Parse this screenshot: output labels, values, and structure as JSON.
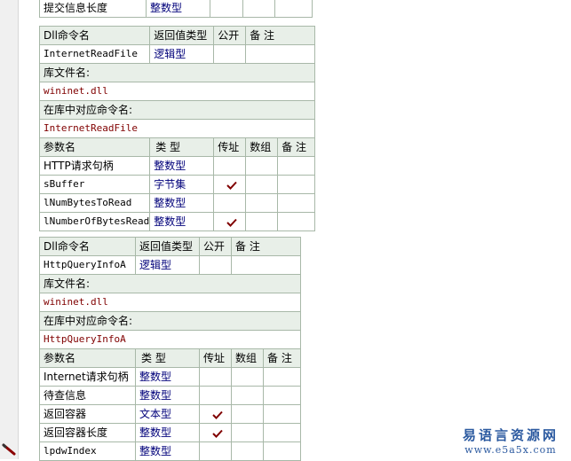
{
  "top_row": {
    "label": "提交信息长度",
    "type": "整数型"
  },
  "headers": {
    "dll_command": "Dll命令名",
    "return_type": "返回值类型",
    "public": "公开",
    "note": "备 注",
    "lib_name": "库文件名:",
    "lib_cmd_name": "在库中对应命令名:",
    "param_name": "参数名",
    "type": "类 型",
    "by_ref": "传址",
    "array": "数组"
  },
  "commands": [
    {
      "name": "InternetReadFile",
      "return_type": "逻辑型",
      "lib_file": "wininet.dll",
      "lib_command": "InternetReadFile",
      "params": [
        {
          "name": "HTTP请求句柄",
          "type": "整数型",
          "by_ref": false
        },
        {
          "name": "sBuffer",
          "type": "字节集",
          "by_ref": true
        },
        {
          "name": "lNumBytesToRead",
          "type": "整数型",
          "by_ref": false
        },
        {
          "name": "lNumberOfBytesRead",
          "type": "整数型",
          "by_ref": true
        }
      ]
    },
    {
      "name": "HttpQueryInfoA",
      "return_type": "逻辑型",
      "lib_file": "wininet.dll",
      "lib_command": "HttpQueryInfoA",
      "params": [
        {
          "name": "Internet请求句柄",
          "type": "整数型",
          "by_ref": false
        },
        {
          "name": "待查信息",
          "type": "整数型",
          "by_ref": false
        },
        {
          "name": "返回容器",
          "type": "文本型",
          "by_ref": true
        },
        {
          "name": "返回容器长度",
          "type": "整数型",
          "by_ref": true
        },
        {
          "name": "lpdwIndex",
          "type": "整数型",
          "by_ref": false
        }
      ]
    }
  ],
  "watermark": {
    "top": "易语言资源网",
    "bottom": "www.e5a5x.com"
  },
  "icons": {
    "check": "checkmark-icon",
    "pencil": "pencil-icon"
  },
  "colors": {
    "header_bg": "#e8efe8",
    "border": "#a8b8a8",
    "link": "#00007a",
    "lib_text": "#800000",
    "watermark": "#2c5aa0"
  }
}
